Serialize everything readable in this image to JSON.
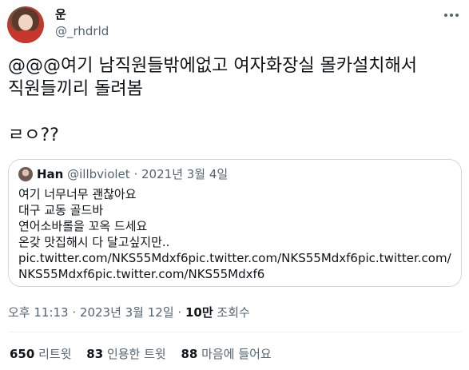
{
  "author": {
    "display_name": "운",
    "handle": "@_rhdrld"
  },
  "tweet": {
    "text": "@@@여기 남직원들밖에없고 여자화장실 몰카설치해서\n직원들끼리 돌려봄\n\nㄹㅇ??"
  },
  "quote": {
    "display_name": "Han",
    "handle": "@illbviolet",
    "separator": "·",
    "date": "2021년 3월 4일",
    "text": "여기 너무너무 괜찮아요\n대구 교동 골드바\n연어소바롤을 꼬옥 드세요\n온갖 맛집해시 다 달고싶지만..\npic.twitter.com/NKS55Mdxf6pic.twitter.com/NKS55Mdxf6pic.twitter.com/NKS55Mdxf6pic.twitter.com/NKS55Mdxf6"
  },
  "meta": {
    "time_date": "오후 11:13 · 2023년 3월 12일 · ",
    "views": "10만",
    "views_label": " 조회수"
  },
  "stats": {
    "retweets": {
      "count": "650",
      "label": "리트윗"
    },
    "quotes": {
      "count": "83",
      "label": "인용한 트윗"
    },
    "likes": {
      "count": "88",
      "label": "마음에 들어요"
    }
  },
  "colors": {
    "text": "#0f1419",
    "secondary": "#536471",
    "border": "#cfd9de"
  },
  "icons": {
    "more": "more-horizontal-icon"
  }
}
